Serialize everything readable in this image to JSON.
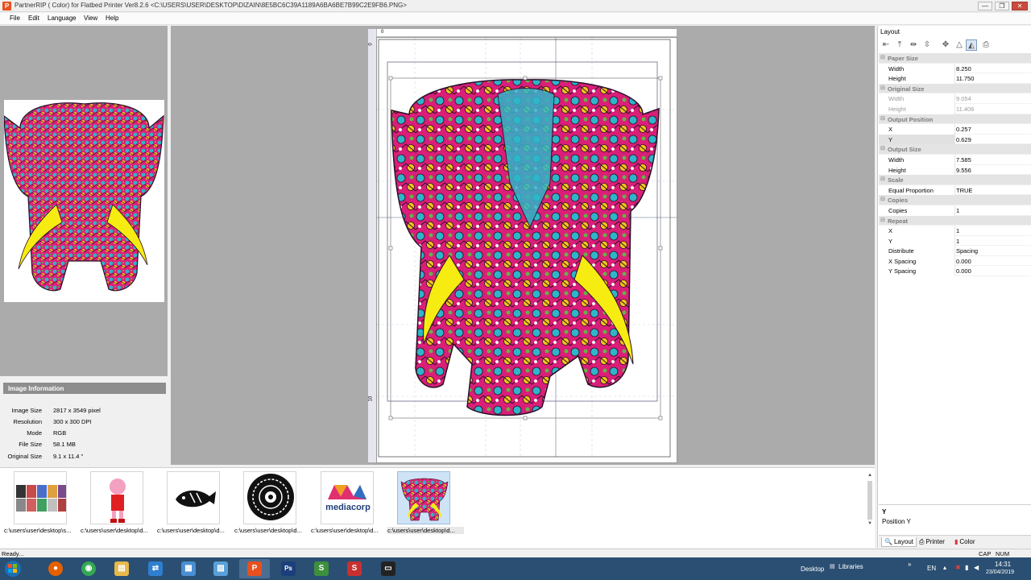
{
  "window": {
    "title": "PartnerRIP ( Color) for Flatbed Printer Ver8.2.6 <C:\\USERS\\USER\\DESKTOP\\DIZAIN\\8E5BC6C39A1189A6BA6BE7B99C2E9FB6.PNG>",
    "icon_letter": "P",
    "minimize_glyph": "—",
    "maximize_glyph": "❐",
    "close_glyph": "✕"
  },
  "menu": [
    "File",
    "Edit",
    "Language",
    "View",
    "Help"
  ],
  "image_info": {
    "header": "Image Information",
    "rows": [
      {
        "label": "Image Size",
        "value": "2817 x 3549 pixel"
      },
      {
        "label": "Resolution",
        "value": "300 x 300 DPI"
      },
      {
        "label": "Mode",
        "value": "RGB"
      },
      {
        "label": "File Size",
        "value": "58.1 MB"
      },
      {
        "label": "Original Size",
        "value": "9.1 x 11.4 \""
      }
    ]
  },
  "ruler": {
    "top_zero": "0",
    "left_zero": "0",
    "left_ten": "10"
  },
  "layout": {
    "title": "Layout",
    "tools": [
      "align-left-icon",
      "align-top-icon",
      "align-hcenter-icon",
      "align-vcenter-icon",
      "center-icon",
      "fit-icon",
      "fill-icon",
      "print-preview-icon"
    ],
    "sections": [
      {
        "name": "Paper Size",
        "rows": [
          {
            "key": "Width",
            "value": "8.250"
          },
          {
            "key": "Height",
            "value": "11.750"
          }
        ]
      },
      {
        "name": "Original Size",
        "muted": true,
        "rows": [
          {
            "key": "Width",
            "value": "9.054"
          },
          {
            "key": "Height",
            "value": "11.406"
          }
        ]
      },
      {
        "name": "Output Position",
        "rows": [
          {
            "key": "X",
            "value": "0.257"
          },
          {
            "key": "Y",
            "value": "0.629",
            "selected": true
          }
        ]
      },
      {
        "name": "Output Size",
        "rows": [
          {
            "key": "Width",
            "value": "7.585"
          },
          {
            "key": "Height",
            "value": "9.556"
          }
        ]
      },
      {
        "name": "Scale",
        "rows": [
          {
            "key": "Equal Proportion",
            "value": "TRUE"
          }
        ]
      },
      {
        "name": "Copies",
        "rows": [
          {
            "key": "Copies",
            "value": "1"
          }
        ]
      },
      {
        "name": "Repeat",
        "rows": [
          {
            "key": "X",
            "value": "1"
          },
          {
            "key": "Y",
            "value": "1"
          },
          {
            "key": "Distribute",
            "value": "Spacing"
          },
          {
            "key": "X Spacing",
            "value": "0.000"
          },
          {
            "key": "Y Spacing",
            "value": "0.000"
          }
        ]
      }
    ],
    "collapse_glyph": "⊟",
    "description_title": "Y",
    "description_text": "Position Y",
    "tabs": [
      {
        "label": "Layout",
        "icon": "layout-tab-icon",
        "active": true
      },
      {
        "label": "Printer",
        "icon": "printer-tab-icon"
      },
      {
        "label": "Color",
        "icon": "color-tab-icon"
      }
    ]
  },
  "thumbnails": [
    {
      "caption": "c:\\users\\user\\desktop\\s...",
      "kind": "photo-grid"
    },
    {
      "caption": "c:\\users\\user\\desktop\\d...",
      "kind": "cartoon"
    },
    {
      "caption": "c:\\users\\user\\desktop\\d...",
      "kind": "fish"
    },
    {
      "caption": "c:\\users\\user\\desktop\\d...",
      "kind": "mandala"
    },
    {
      "caption": "c:\\users\\user\\desktop\\d...",
      "kind": "logo",
      "logo_text": "mediacorp"
    },
    {
      "caption": "c:\\users\\user\\desktop\\d...",
      "kind": "elephant",
      "selected": true
    }
  ],
  "status": {
    "text": "Ready...",
    "cap": "CAP",
    "num": "NUM"
  },
  "taskbar": {
    "apps": [
      {
        "name": "firefox-app",
        "color": "#e66000",
        "glyph": "●"
      },
      {
        "name": "chrome-app",
        "color": "#34a853",
        "glyph": "◉"
      },
      {
        "name": "explorer-app",
        "color": "#e8b84a",
        "glyph": "▤"
      },
      {
        "name": "teamviewer-app",
        "color": "#2f7fd0",
        "glyph": "⇄"
      },
      {
        "name": "control-panel-app",
        "color": "#4a8fd0",
        "glyph": "▦"
      },
      {
        "name": "photos-app",
        "color": "#5aa0d8",
        "glyph": "▨"
      },
      {
        "name": "partnerrip-app",
        "color": "#e8501e",
        "glyph": "P",
        "active": true
      },
      {
        "name": "photoshop-app",
        "color": "#1b3f7a",
        "glyph": "Ps"
      },
      {
        "name": "corel-app",
        "color": "#3d8f3d",
        "glyph": "S"
      },
      {
        "name": "soft-app",
        "color": "#c83030",
        "glyph": "S"
      },
      {
        "name": "terminal-app",
        "color": "#222222",
        "glyph": "▭"
      }
    ],
    "desktop_label": "Desktop",
    "libraries_label": "Libraries",
    "chevron": "»",
    "lang": "EN",
    "time": "14:31",
    "date": "23/04/2019"
  }
}
